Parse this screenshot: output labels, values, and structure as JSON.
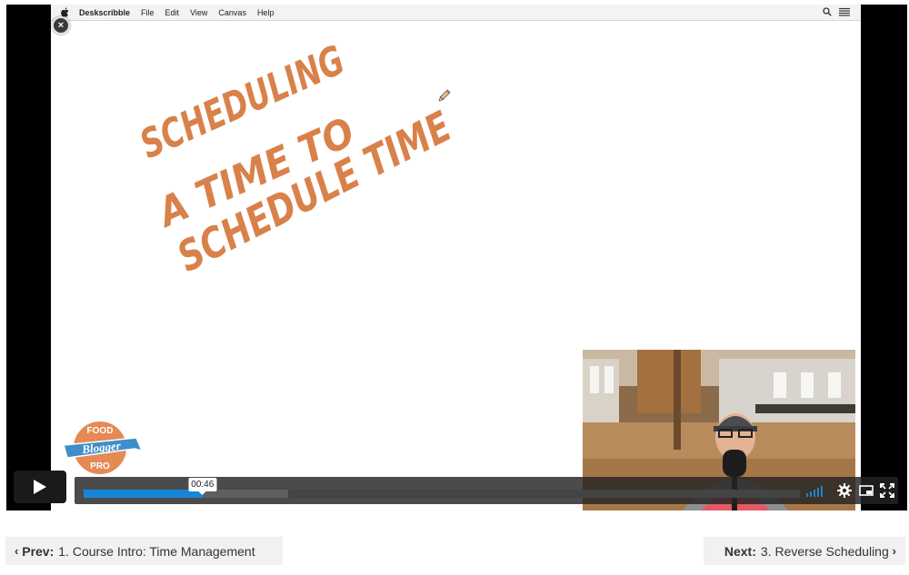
{
  "menubar": {
    "app_name": "Deskscribble",
    "items": [
      "File",
      "Edit",
      "View",
      "Canvas",
      "Help"
    ]
  },
  "canvas": {
    "handwritten_lines": [
      "SCHEDULING",
      "A TIME TO",
      "SCHEDULE TIME"
    ],
    "ink_color": "#d9814a"
  },
  "logo": {
    "line1": "FOOD",
    "line2": "Blogger",
    "line3": "PRO"
  },
  "player": {
    "time_tooltip": "00:46",
    "progress_fraction": 0.166,
    "buffered_fraction": 0.285,
    "accent_color": "#1786d8"
  },
  "navigation": {
    "prev_prefix": "Prev:",
    "prev_title": "1. Course Intro: Time Management",
    "next_prefix": "Next:",
    "next_title": "3. Reverse Scheduling"
  }
}
